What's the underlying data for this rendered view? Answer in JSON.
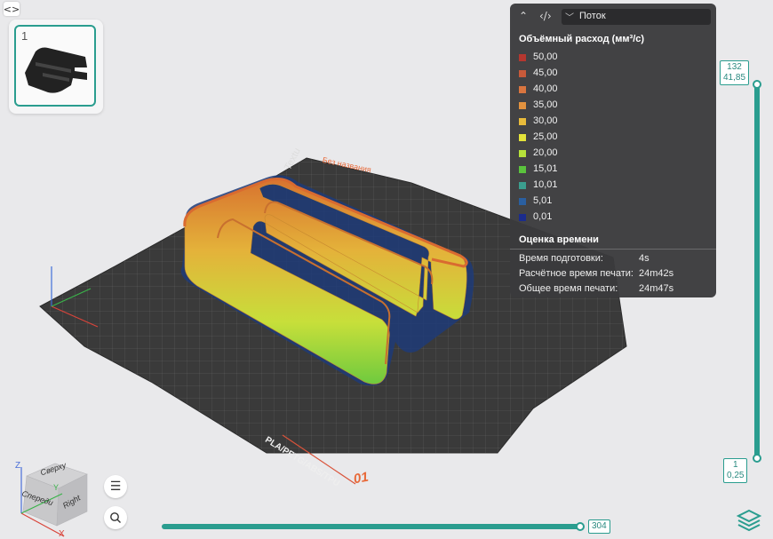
{
  "thumbnail": {
    "plate_number": "1"
  },
  "legend": {
    "view_type": "Поток",
    "title": "Объёмный расход (мм³/с)",
    "items": [
      {
        "label": "50,00",
        "color": "#b5372f"
      },
      {
        "label": "45,00",
        "color": "#c85a3a"
      },
      {
        "label": "40,00",
        "color": "#d9753f"
      },
      {
        "label": "35,00",
        "color": "#e2923f"
      },
      {
        "label": "30,00",
        "color": "#e8bb3b"
      },
      {
        "label": "25,00",
        "color": "#e4e33a"
      },
      {
        "label": "20,00",
        "color": "#b6e23a"
      },
      {
        "label": "15,01",
        "color": "#5bc33d"
      },
      {
        "label": "10,01",
        "color": "#3b9e8e"
      },
      {
        "label": "5,01",
        "color": "#2a5fa0"
      },
      {
        "label": "0,01",
        "color": "#1b2c8c"
      }
    ]
  },
  "time_estimate": {
    "title": "Оценка времени",
    "rows": [
      {
        "key": "Время подготовки:",
        "value": "4s"
      },
      {
        "key": "Расчётное время печати:",
        "value": "24m42s"
      },
      {
        "key": "Общее время печати:",
        "value": "24m47s"
      }
    ]
  },
  "layer_slider": {
    "top_layer": "132",
    "top_height": "41,85",
    "bottom_layer": "1",
    "bottom_height": "0,25"
  },
  "move_slider": {
    "value": "304"
  },
  "plate": {
    "texture_label": "Textu",
    "name_label": "Без названия",
    "material_label": "PLA/PETG/ABS/TPU",
    "plate_number_label": "01"
  },
  "view_cube": {
    "top": "Сверху",
    "front": "Спереди",
    "right": "Right",
    "x": "X",
    "y": "Y",
    "z": "Z"
  },
  "accent_color": "#2a9d8f"
}
